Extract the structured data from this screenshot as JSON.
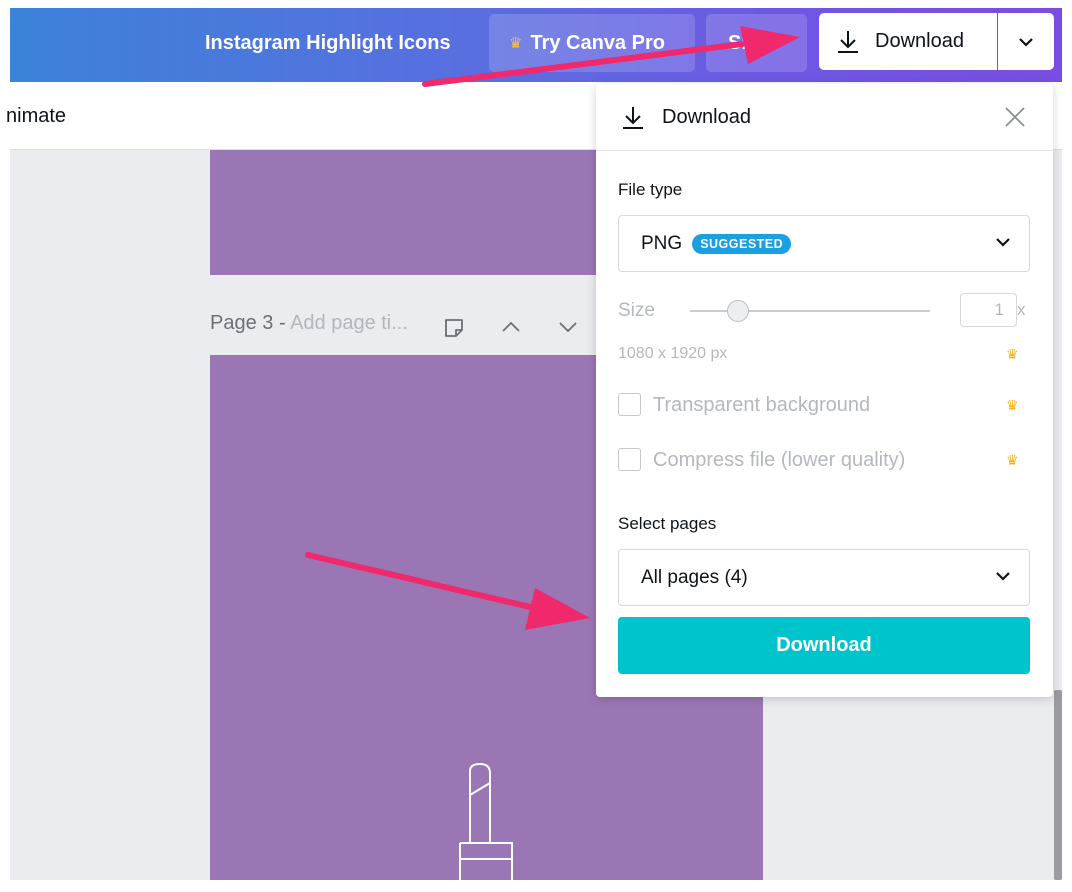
{
  "header": {
    "doc_title": "Instagram Highlight Icons",
    "try_pro_label": "Try Canva Pro",
    "share_label": "Sh",
    "download_label": "Download"
  },
  "toolbar": {
    "animate_label": "nimate"
  },
  "canvas": {
    "page_label": "Page 3 - ",
    "page_title_placeholder": "Add page ti..."
  },
  "download_panel": {
    "title": "Download",
    "file_type_label": "File type",
    "file_type_value": "PNG",
    "file_type_badge": "SUGGESTED",
    "size_label": "Size",
    "size_value": "1",
    "size_suffix": "x",
    "dimensions": "1080 x 1920 px",
    "transparent_label": "Transparent background",
    "transparent_checked": false,
    "compress_label": "Compress file (lower quality)",
    "compress_checked": false,
    "select_pages_label": "Select pages",
    "select_pages_value": "All pages (4)",
    "download_button_label": "Download"
  },
  "colors": {
    "accent_download": "#00c4cc",
    "badge": "#1a9fe0",
    "crown": "#f1b31a",
    "annotation_arrow": "#f0286c",
    "design_background": "#9b76b4"
  }
}
